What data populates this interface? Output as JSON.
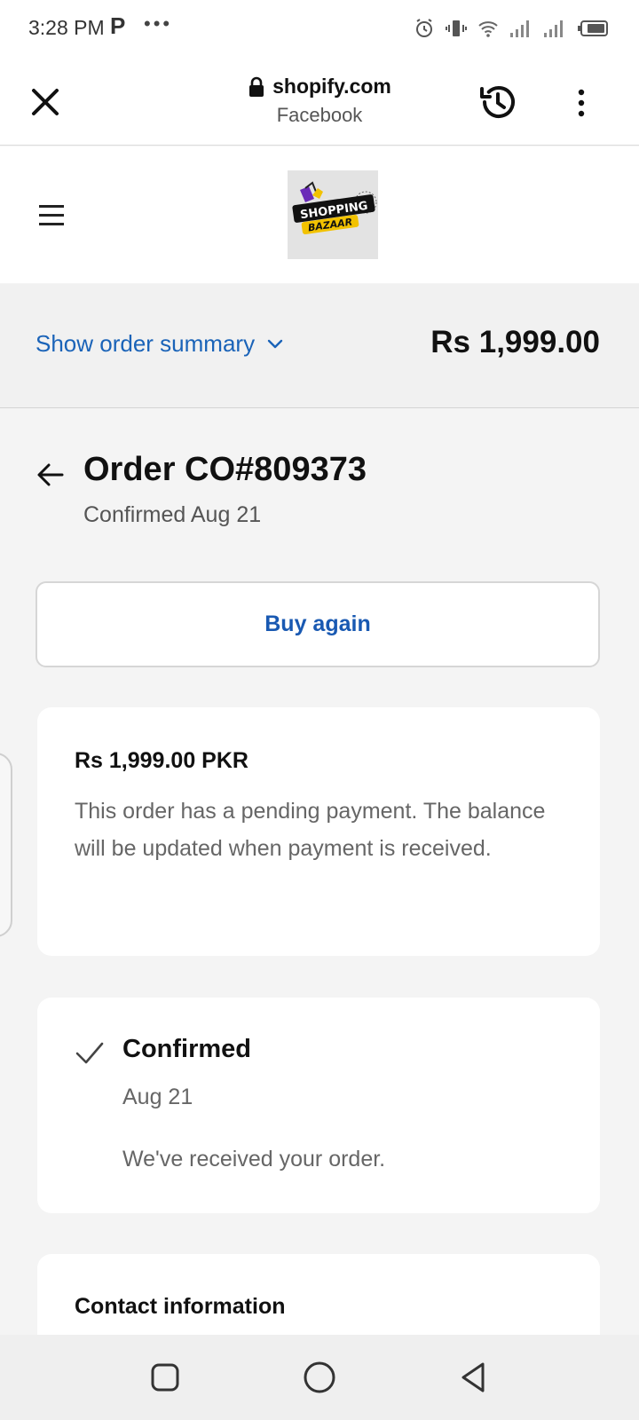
{
  "status_bar": {
    "time": "3:28 PM",
    "app_letter": "P",
    "overflow": "•••",
    "icons": [
      "alarm-icon",
      "vibrate-icon",
      "wifi-icon",
      "signal-icon",
      "signal-icon",
      "battery-icon"
    ]
  },
  "browser": {
    "domain": "shopify.com",
    "source": "Facebook",
    "icons": [
      "close-icon",
      "lock-icon",
      "history-icon",
      "more-vert-icon"
    ]
  },
  "shop": {
    "logo_text_top": "SHOPPING",
    "logo_text_bottom": "BAZAAR",
    "icons": [
      "menu-icon"
    ]
  },
  "summary": {
    "toggle_label": "Show order summary",
    "total": "Rs 1,999.00",
    "accent_color": "#1a63b8"
  },
  "order": {
    "title": "Order CO#809373",
    "subtitle": "Confirmed Aug 21",
    "buy_again_label": "Buy again"
  },
  "pending_card": {
    "amount": "Rs 1,999.00 PKR",
    "message": "This order has a pending payment. The balance will be updated when payment is received."
  },
  "confirmed_card": {
    "status": "Confirmed",
    "date": "Aug 21",
    "message": "We've received your order."
  },
  "contact_card": {
    "title": "Contact information"
  },
  "nav_bar": {
    "icons": [
      "recents-icon",
      "home-icon",
      "back-icon"
    ]
  }
}
